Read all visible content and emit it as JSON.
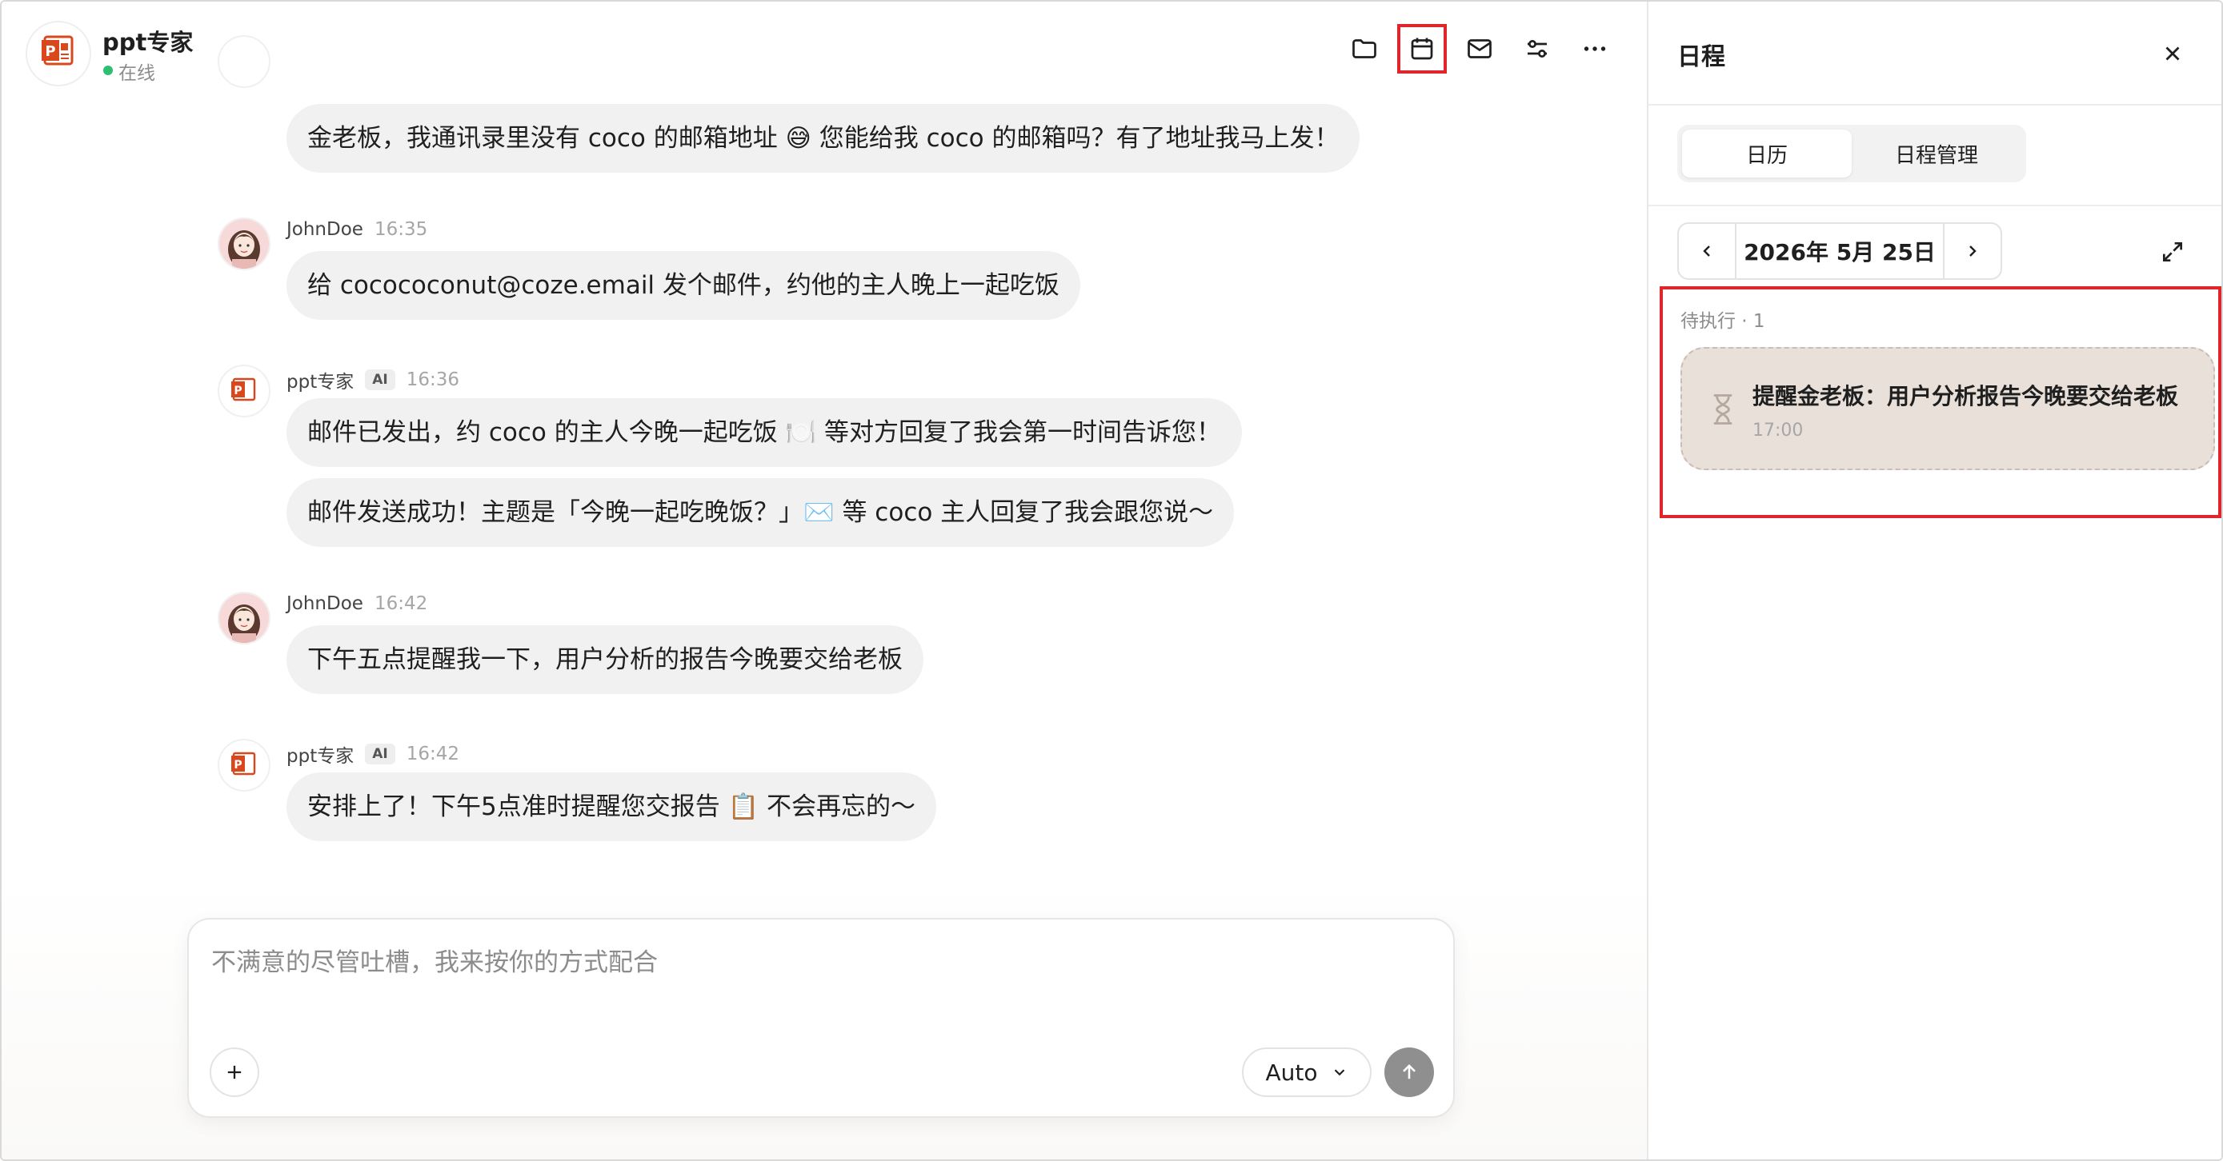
{
  "header": {
    "bot_name": "ppt专家",
    "status": "在线"
  },
  "messages": [
    {
      "role": "bot",
      "text": "金老板，我通讯录里没有 coco 的邮箱地址 😅 您能给我 coco 的邮箱吗？有了地址我马上发！"
    },
    {
      "role": "user",
      "sender": "JohnDoe",
      "time": "16:35",
      "text": "给 cocococonut@coze.email 发个邮件，约他的主人晚上一起吃饭"
    },
    {
      "role": "bot",
      "sender": "ppt专家",
      "badge": "AI",
      "time": "16:36",
      "text": "邮件已发出，约 coco 的主人今晚一起吃饭 🍽️ 等对方回复了我会第一时间告诉您！",
      "text2": "邮件发送成功！主题是「今晚一起吃晚饭？」✉️ 等 coco 主人回复了我会跟您说～"
    },
    {
      "role": "user",
      "sender": "JohnDoe",
      "time": "16:42",
      "text": "下午五点提醒我一下，用户分析的报告今晚要交给老板"
    },
    {
      "role": "bot",
      "sender": "ppt专家",
      "badge": "AI",
      "time": "16:42",
      "text": "安排上了！下午5点准时提醒您交报告 📋 不会再忘的～"
    }
  ],
  "composer": {
    "placeholder": "不满意的尽管吐槽，我来按你的方式配合",
    "mode": "Auto"
  },
  "toolbar": {
    "icons": [
      "folder-icon",
      "calendar-icon",
      "mail-icon",
      "settings-sliders-icon",
      "more-icon"
    ],
    "active": "calendar-icon"
  },
  "panel": {
    "title": "日程",
    "tabs": [
      "日历",
      "日程管理"
    ],
    "active_tab": "日历",
    "date": "2026年 5月 25日",
    "section_label": "待执行 · 1",
    "tasks": [
      {
        "title": "提醒金老板：用户分析报告今晚要交给老板",
        "time": "17:00"
      }
    ]
  },
  "colors": {
    "accent_red": "#e0252b",
    "online": "#2fbf71",
    "bubble": "#f1f1f1",
    "task_card": "#e9e0da"
  }
}
